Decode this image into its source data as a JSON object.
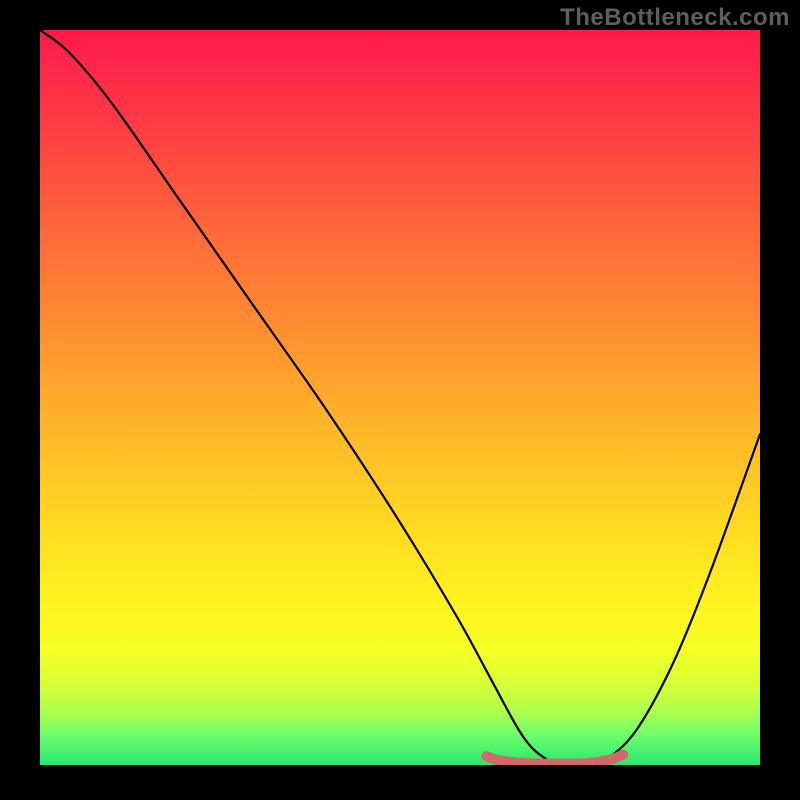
{
  "watermark": "TheBottleneck.com",
  "chart_data": {
    "type": "line",
    "title": "",
    "xlabel": "",
    "ylabel": "",
    "xlim": [
      0,
      100
    ],
    "ylim": [
      0,
      100
    ],
    "legend": false,
    "grid": false,
    "background": "red-yellow-green vertical gradient",
    "series": [
      {
        "name": "bottleneck-curve",
        "color": "#000000",
        "x": [
          0,
          4,
          10,
          20,
          30,
          40,
          50,
          58,
          63,
          67,
          70,
          73,
          76,
          79,
          83,
          88,
          93,
          100
        ],
        "values": [
          100,
          97,
          90,
          76,
          62,
          48,
          33,
          20,
          11,
          4,
          1,
          0,
          0,
          1,
          5,
          14,
          26,
          45
        ]
      },
      {
        "name": "optimal-range-marker",
        "color": "#d06a6a",
        "x": [
          62,
          64,
          68,
          72,
          76,
          79,
          81
        ],
        "values": [
          1.2,
          0.6,
          0.25,
          0.2,
          0.25,
          0.7,
          1.4
        ]
      }
    ],
    "annotations": []
  }
}
